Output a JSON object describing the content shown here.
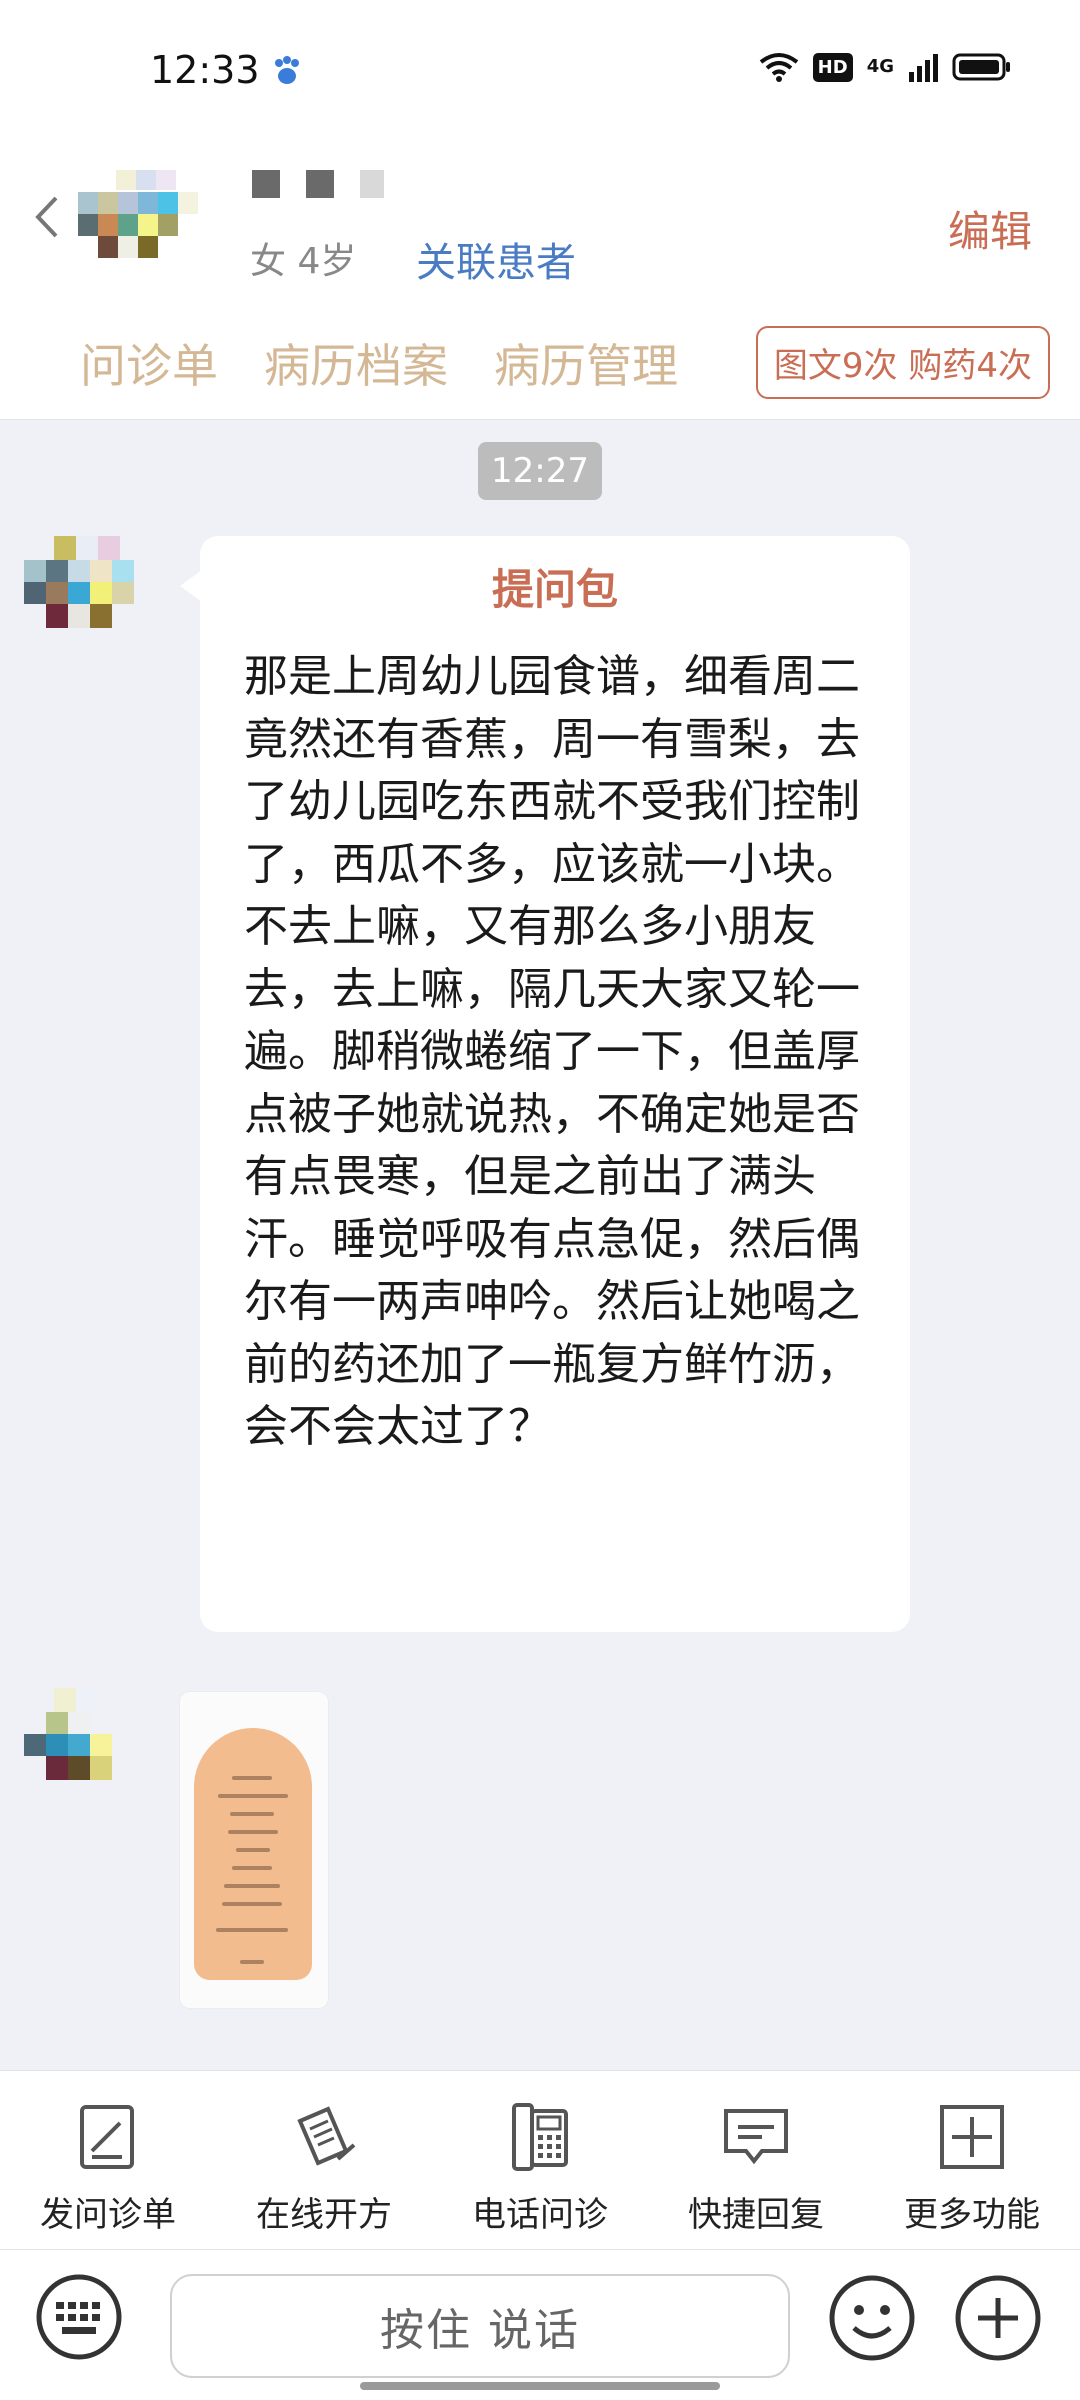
{
  "status_bar": {
    "time": "12:33",
    "network_badge": "HD",
    "network_type": "4G"
  },
  "header": {
    "gender_age": "女 4岁",
    "link_patient_label": "关联患者",
    "edit_label": "编辑",
    "tabs": [
      "问诊单",
      "病历档案",
      "病历管理"
    ],
    "stats_badge": "图文9次 购药4次"
  },
  "chat": {
    "timestamp": "12:27",
    "message": {
      "title": "提问包",
      "body": "那是上周幼儿园食谱，细看周二竟然还有香蕉，周一有雪梨，去了幼儿园吃东西就不受我们控制了，西瓜不多，应该就一小块。不去上嘛，又有那么多小朋友去，去上嘛，隔几天大家又轮一遍。脚稍微蜷缩了一下，但盖厚点被子她就说热，不确定她是否有点畏寒，但是之前出了满头汗。睡觉呼吸有点急促，然后偶尔有一两声呻吟。然后让她喝之前的药还加了一瓶复方鲜竹沥，会不会太过了？"
    }
  },
  "toolbar": {
    "items": [
      {
        "label": "发问诊单",
        "icon": "form-edit-icon"
      },
      {
        "label": "在线开方",
        "icon": "prescription-icon"
      },
      {
        "label": "电话问诊",
        "icon": "phone-icon"
      },
      {
        "label": "快捷回复",
        "icon": "message-icon"
      },
      {
        "label": "更多功能",
        "icon": "plus-box-icon"
      }
    ]
  },
  "input_bar": {
    "voice_label": "按住 说话"
  },
  "colors": {
    "accent": "#c96e55",
    "link": "#4a7cc4",
    "tab_text": "#d4b896",
    "background": "#f0f1f6"
  }
}
